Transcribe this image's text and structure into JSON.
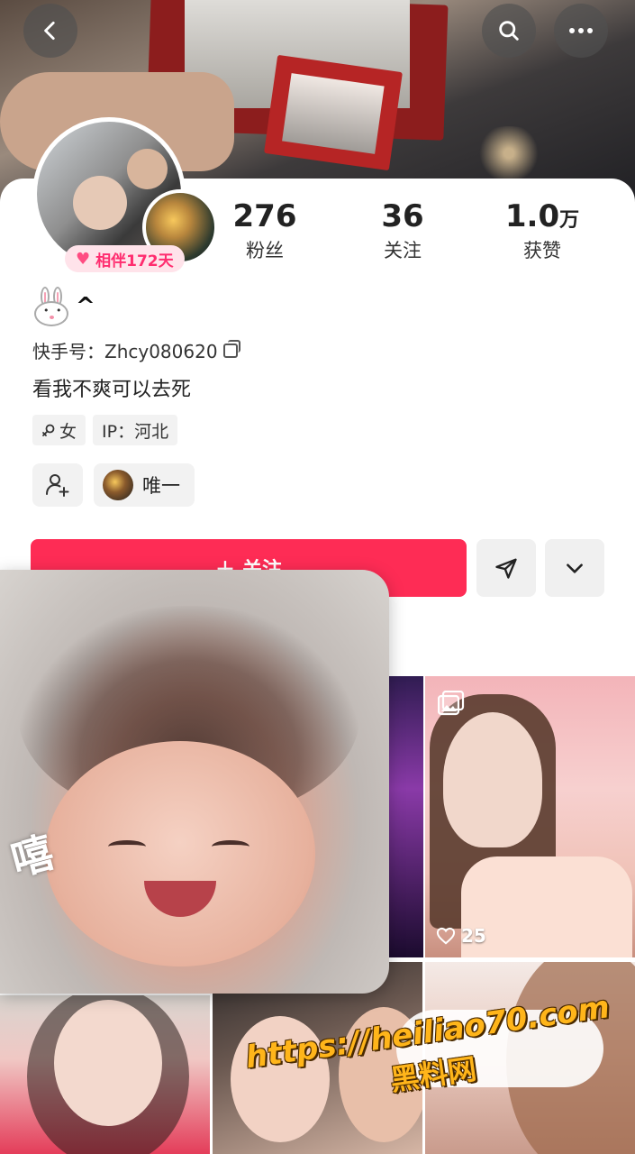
{
  "stats": {
    "fans": {
      "value": "276",
      "label": "粉丝"
    },
    "following": {
      "value": "36",
      "label": "关注"
    },
    "likes": {
      "value": "1.0",
      "unit": "万",
      "label": "获赞"
    }
  },
  "badge": {
    "text": "相伴172天"
  },
  "profile": {
    "nickname_suffix": "^",
    "kuaishou_id": "快手号：Zhcy080620",
    "bio": "看我不爽可以去死",
    "tags": [
      {
        "icon": "female-icon",
        "text": "女"
      },
      {
        "text": "IP：河北"
      }
    ],
    "related_user": "唯一"
  },
  "actions": {
    "follow_label": "关注"
  },
  "grid": {
    "tile2_likes": "25"
  },
  "overlay": {
    "sticker_text": "嘻"
  },
  "watermark": {
    "url": "https://heiliao70.com",
    "name": "黑料网"
  }
}
